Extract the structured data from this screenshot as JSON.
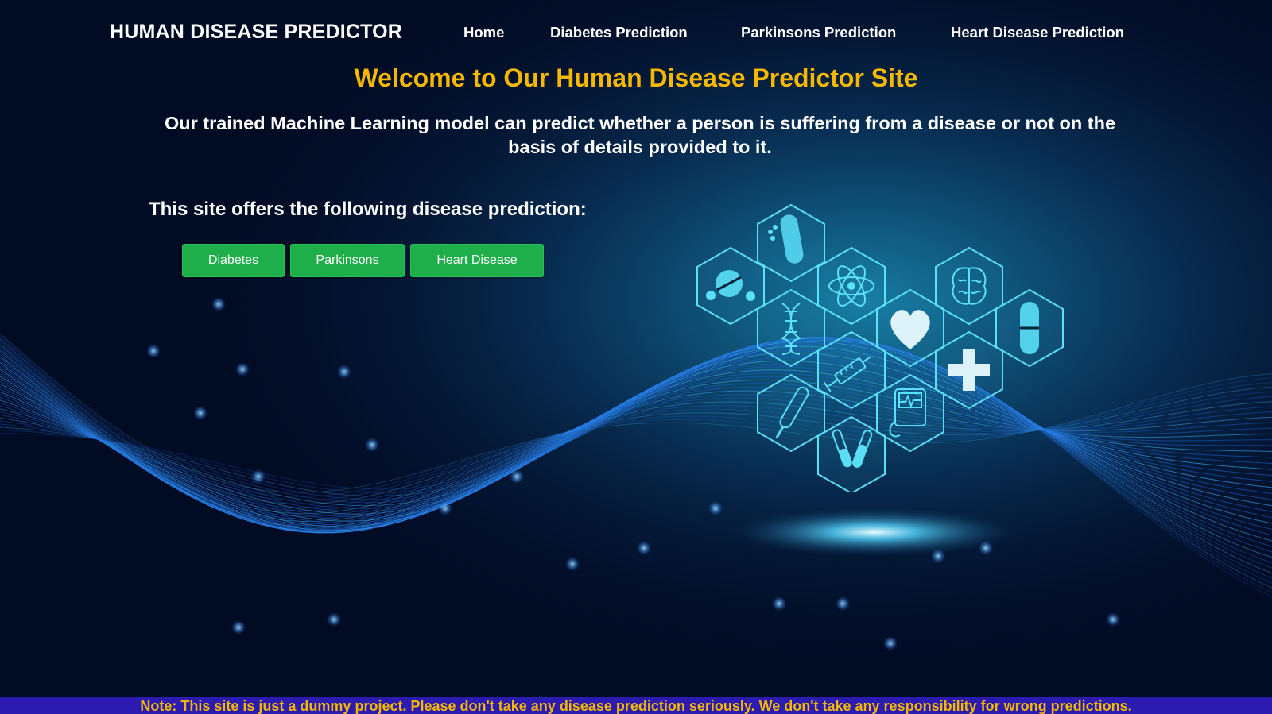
{
  "navbar": {
    "brand": "HUMAN DISEASE PREDICTOR",
    "links": [
      "Home",
      "Diabetes Prediction",
      "Parkinsons Prediction",
      "Heart Disease Prediction"
    ]
  },
  "main": {
    "welcome": "Welcome to Our Human Disease Predictor Site",
    "intro": "Our trained Machine Learning model can predict whether a person is suffering from a disease or not on the basis of details provided to it.",
    "offers_heading": "This site offers the following disease prediction:",
    "buttons": [
      "Diabetes",
      "Parkinsons",
      "Heart Disease"
    ]
  },
  "illustration": {
    "icons": [
      "pill-bottle-icon",
      "pill-icon",
      "atom-icon",
      "brain-icon",
      "capsule-icon",
      "dna-icon",
      "heart-icon",
      "syringe-icon",
      "medical-cross-icon",
      "thermometer-icon",
      "heart-monitor-icon",
      "test-tubes-icon"
    ]
  },
  "footer": {
    "note": "Note: This site is just a dummy project. Please don't take any disease prediction seriously. We don't take any responsibility for wrong predictions."
  },
  "colors": {
    "background": "#020b24",
    "accent": "#f5b800",
    "button": "#1eae4a",
    "footer_bg": "#2b1bb0",
    "icon_glow": "#5fe8ff"
  }
}
